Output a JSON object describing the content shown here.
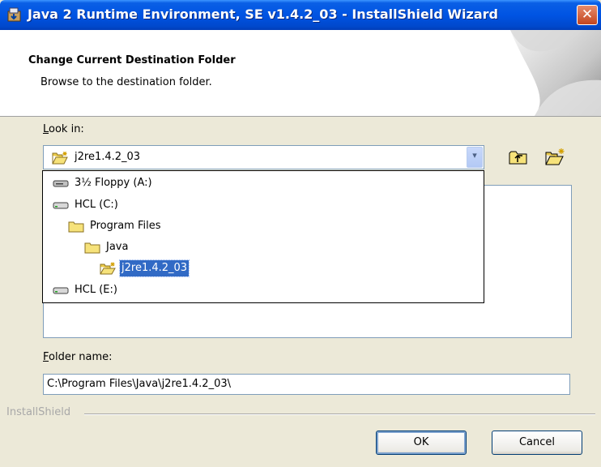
{
  "window": {
    "title": "Java 2 Runtime Environment, SE v1.4.2_03 - InstallShield Wizard",
    "close_glyph": "✕"
  },
  "header": {
    "title": "Change Current Destination Folder",
    "subtitle": "Browse to the destination folder."
  },
  "look_in": {
    "label_accel": "L",
    "label_rest": "ook in:",
    "value": "j2re1.4.2_03",
    "dropdown_glyph": "▾"
  },
  "dropdown": {
    "items": [
      {
        "label": "3½ Floppy (A:)",
        "icon": "floppy-drive-icon"
      },
      {
        "label": "HCL (C:)",
        "icon": "hard-drive-icon"
      },
      {
        "label": "Program Files",
        "icon": "folder-icon"
      },
      {
        "label": "Java",
        "icon": "folder-icon"
      },
      {
        "label": "j2re1.4.2_03",
        "icon": "open-folder-icon",
        "selected": true
      },
      {
        "label": "HCL (E:)",
        "icon": "hard-drive-icon"
      }
    ]
  },
  "folder_name": {
    "label_accel": "F",
    "label_rest": "older name:",
    "value": "C:\\Program Files\\Java\\j2re1.4.2_03\\"
  },
  "footer": {
    "brand": "InstallShield"
  },
  "buttons": {
    "ok": "OK",
    "cancel": "Cancel"
  },
  "colors": {
    "titlebar": "#0054E3",
    "selection": "#316AC5",
    "face": "#ECE9D8"
  }
}
